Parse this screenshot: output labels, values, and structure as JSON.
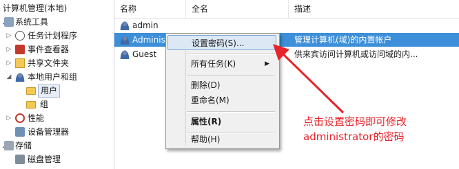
{
  "tree": {
    "root": "计算机管理(本地)",
    "system_tools": "系统工具",
    "task_scheduler": "任务计划程序",
    "event_viewer": "事件查看器",
    "shared_folders": "共享文件夹",
    "local_users_groups": "本地用户和组",
    "users": "用户",
    "groups": "组",
    "performance": "性能",
    "device_manager": "设备管理器",
    "storage": "存储",
    "disk_management": "磁盘管理"
  },
  "columns": {
    "name": "名称",
    "fullname": "全名",
    "description": "描述"
  },
  "users": [
    {
      "name": "admin",
      "description": ""
    },
    {
      "name": "Administ",
      "description": "管理计算机(域)的内置帐户"
    },
    {
      "name": "Guest",
      "description": "供来宾访问计算机或访问域的内..."
    }
  ],
  "context_menu": {
    "set_password": "设置密码(S)...",
    "all_tasks": "所有任务(K)",
    "delete": "删除(D)",
    "rename": "重命名(M)",
    "properties": "属性(R)",
    "help": "帮助(H)"
  },
  "annotation": {
    "line1": "点击设置密码即可修改",
    "line2": "administrator的密码"
  },
  "colors": {
    "selection": "#3c8fd8",
    "annotation": "#e8232a"
  }
}
